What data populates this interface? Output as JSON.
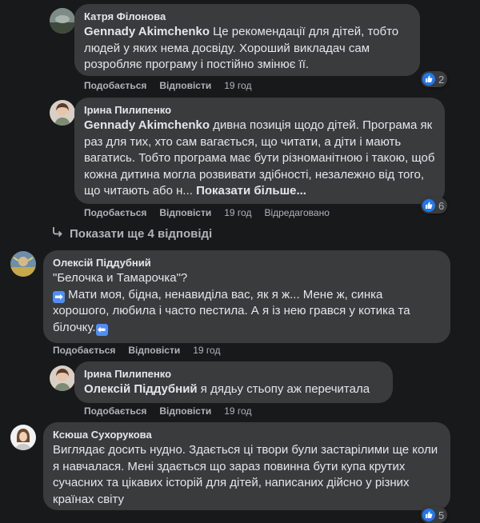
{
  "colors": {
    "background": "#18191a",
    "bubble": "#3a3b3c",
    "like": "#2078f4",
    "muted": "#b0b3b8"
  },
  "comments": [
    {
      "author": "Катря Філонова",
      "mention": "Gennady Akimchenko",
      "text": " Це рекомендації для дітей, тобто людей у яких нема досвіду. Хороший викладач сам розробляє програму і постійно змінює її.",
      "like": "Подобається",
      "reply": "Відповісти",
      "time": "19 год",
      "reactions": "2"
    },
    {
      "author": "Ірина Пилипенко",
      "mention": "Gennady Akimchenko",
      "text": " дивна позиція щодо дітей. Програма як раз для тих, хто сам вагається, що читати, а діти і мають вагатись. Тобто програма має бути різноманітною і такою, щоб кожна дитина могла розвивати здібності, незалежно від того, що читають або н...",
      "see_more": "Показати більше...",
      "like": "Подобається",
      "reply": "Відповісти",
      "time": "19 год",
      "edited": "Відредаговано",
      "reactions": "6"
    },
    {
      "show_more_replies": "Показати ще 4 відповіді"
    },
    {
      "author": "Олексій Піддубний",
      "line1": "\"Белочка и Тамарочка\"?",
      "text": "Мати моя, бідна, ненавиділа вас, як я ж... Мене ж, синка хорошого, любила і часто пестила. А я із нею грався у котика та білочку.",
      "like": "Подобається",
      "reply": "Відповісти",
      "time": "19 год"
    },
    {
      "author": "Ірина Пилипенко",
      "mention": "Олексій Піддубний",
      "text": " я дядьу стьопу аж перечитала",
      "like": "Подобається",
      "reply": "Відповісти",
      "time": "19 год"
    },
    {
      "author": "Ксюша Сухорукова",
      "text": "Виглядає досить нудно. Здається ці твори були застарілими ще коли я навчалася. Мені здається що зараз повинна бути купа крутих сучасних та цікавих історій для дітей, написаних дійсно у різних країнах світу",
      "reactions": "5"
    }
  ]
}
